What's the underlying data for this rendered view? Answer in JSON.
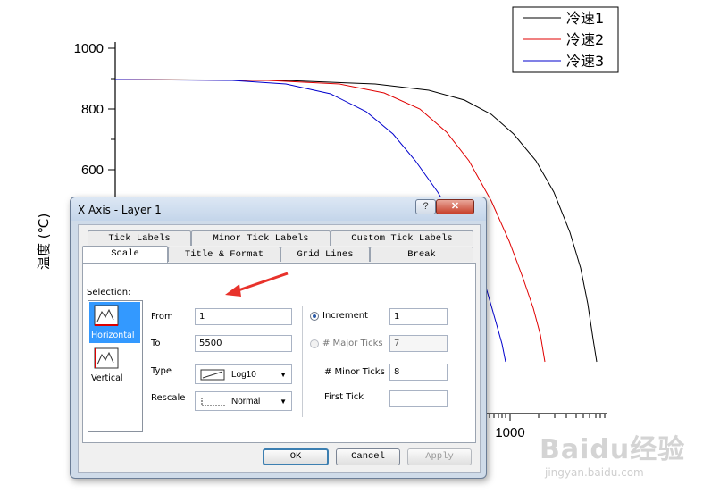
{
  "chart_data": {
    "type": "line",
    "ylabel": "温度 (℃)",
    "xlabel": "",
    "yticks": [
      "1000",
      "800",
      "600"
    ],
    "xticks": [
      "1000"
    ],
    "legend": {
      "placement": "top-right"
    },
    "series": [
      {
        "name": "冷速1",
        "color": "#000000"
      },
      {
        "name": "冷速2",
        "color": "#e00000"
      },
      {
        "name": "冷速3",
        "color": "#0000cc"
      }
    ]
  },
  "dialog": {
    "title": "X Axis - Layer 1",
    "help_glyph": "?",
    "close_glyph": "✕",
    "tabs_row1": [
      "Tick Labels",
      "Minor Tick Labels",
      "Custom Tick Labels"
    ],
    "tabs_row2": [
      "Scale",
      "Title & Format",
      "Grid Lines",
      "Break"
    ],
    "selection_label": "Selection:",
    "selection_items": [
      "Horizontal",
      "Vertical"
    ],
    "from_label": "From",
    "from_value": "1",
    "to_label": "To",
    "to_value": "5500",
    "type_label": "Type",
    "type_value": "Log10",
    "rescale_label": "Rescale",
    "rescale_value": "Normal",
    "increment_label": "Increment",
    "increment_value": "1",
    "major_ticks_label": "# Major Ticks",
    "major_ticks_value": "7",
    "minor_ticks_label": "# Minor Ticks",
    "minor_ticks_value": "8",
    "first_tick_label": "First Tick",
    "first_tick_value": "",
    "ok_label": "OK",
    "cancel_label": "Cancel",
    "apply_label": "Apply",
    "accent_color": "#3399ff",
    "arrow_color": "#e8322b"
  },
  "watermark": {
    "text": "Baidu经验",
    "url": "jingyan.baidu.com"
  }
}
